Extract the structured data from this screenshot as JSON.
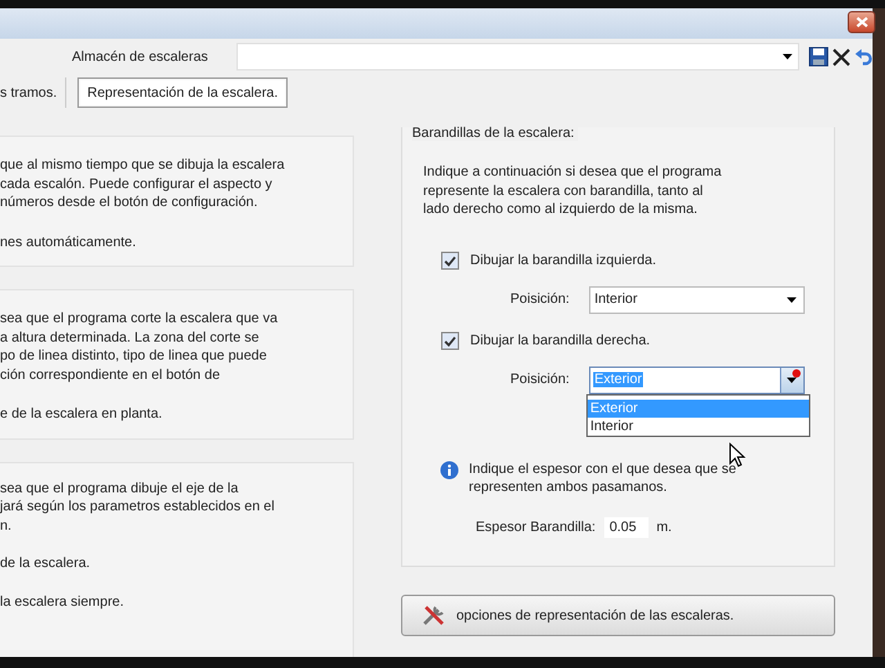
{
  "store": {
    "label": "Almacén de escaleras"
  },
  "tabs": [
    {
      "label": "s tramos.",
      "selected": false
    },
    {
      "label": "Representación de la escalera.",
      "selected": true
    }
  ],
  "left_groups": [
    {
      "blocks": [
        [
          "que al mismo tiempo que se dibuja la escalera",
          "cada escalón. Puede configurar el aspecto y",
          "números desde el botón de configuración."
        ],
        [
          "nes automáticamente."
        ]
      ]
    },
    {
      "blocks": [
        [
          "sea que el programa corte la escalera que va",
          "a altura determinada. La zona del corte se",
          "po de linea distinto, tipo de linea que puede",
          "ción correspondiente en el botón de"
        ],
        [
          "e de la escalera en planta."
        ]
      ]
    },
    {
      "blocks": [
        [
          "sea que el programa dibuje el eje de la",
          "jará según los parametros establecidos en el",
          "n."
        ],
        [
          "de la escalera."
        ],
        [
          "la escalera siempre."
        ]
      ]
    }
  ],
  "railings": {
    "title": "Barandillas de la escalera:",
    "description": "Indique a continuación si desea que el programa represente la escalera con barandilla, tanto al lado derecho como al izquierdo de la misma.",
    "items": [
      {
        "kind": "checkbox",
        "label": "Dibujar la barandilla izquierda.",
        "checked": true
      },
      {
        "kind": "select",
        "label": "Poisición:",
        "value": "Interior",
        "focused": false
      },
      {
        "kind": "checkbox",
        "label": "Dibujar la barandilla derecha.",
        "checked": true
      },
      {
        "kind": "select",
        "label": "Poisición:",
        "value": "Exterior",
        "focused": true
      }
    ],
    "dropdown_options": [
      {
        "label": "Exterior",
        "selected": true
      },
      {
        "label": "Interior",
        "selected": false
      }
    ],
    "note": "Indique el espesor con el que desea que se representen ambos pasamanos.",
    "thickness": {
      "label": "Espesor Barandilla:",
      "value": "0.05",
      "unit": "m."
    }
  },
  "options_button": "opciones de representación de las escaleras."
}
